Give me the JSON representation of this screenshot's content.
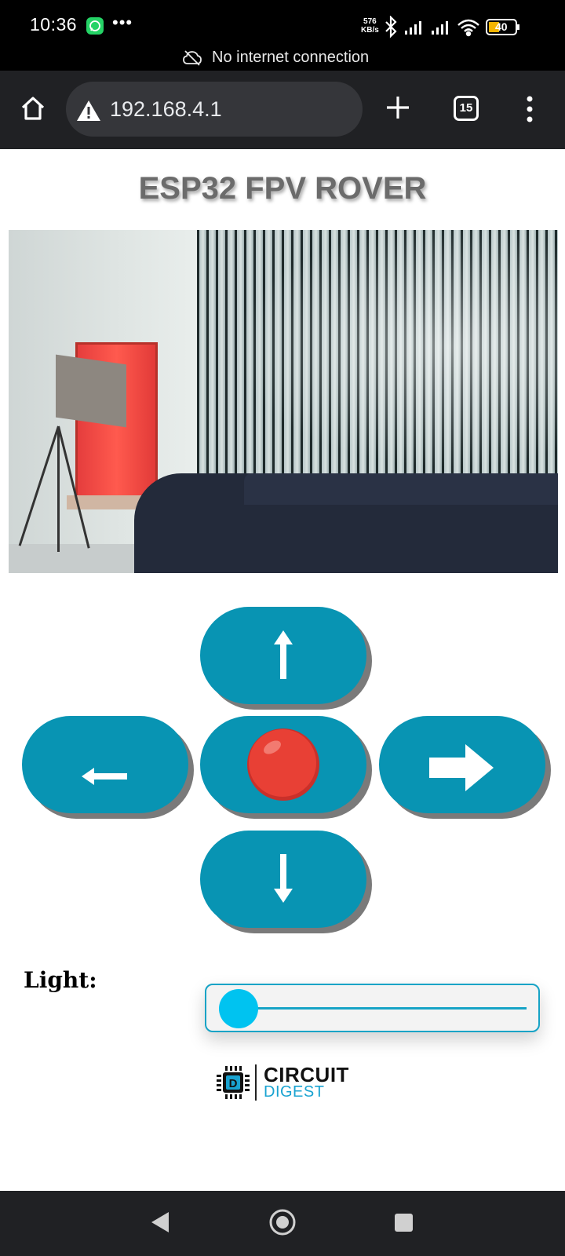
{
  "status_bar": {
    "time": "10:36",
    "net_speed_value": "576",
    "net_speed_unit": "KB/s",
    "battery": "40",
    "icons": [
      "whatsapp-icon",
      "more-dots-icon",
      "bluetooth-icon",
      "signal-icon",
      "signal-icon",
      "wifi-icon",
      "battery-icon"
    ]
  },
  "offline_banner": {
    "text": "No internet connection",
    "icon": "cloud-off-icon"
  },
  "browser": {
    "url": "192.168.4.1",
    "tab_count": "15",
    "icons": [
      "home-icon",
      "warning-icon",
      "plus-icon",
      "tabs-icon",
      "menu-icon"
    ]
  },
  "page": {
    "title": "ESP32 FPV ROVER",
    "controls": {
      "up": "arrow-up-icon",
      "left": "arrow-left-icon",
      "stop": "stop-icon",
      "right": "arrow-right-icon",
      "down": "arrow-down-icon"
    },
    "light": {
      "label": "Light:",
      "value": 0
    },
    "logo": {
      "line1": "CIRCUIT",
      "line2": "DIGEST"
    }
  },
  "colors": {
    "button": "#0894b3",
    "slider_accent": "#16a3c6",
    "stop": "#e84035"
  },
  "nav_bar": {
    "icons": [
      "back-icon",
      "home-circle-icon",
      "recents-icon"
    ]
  }
}
